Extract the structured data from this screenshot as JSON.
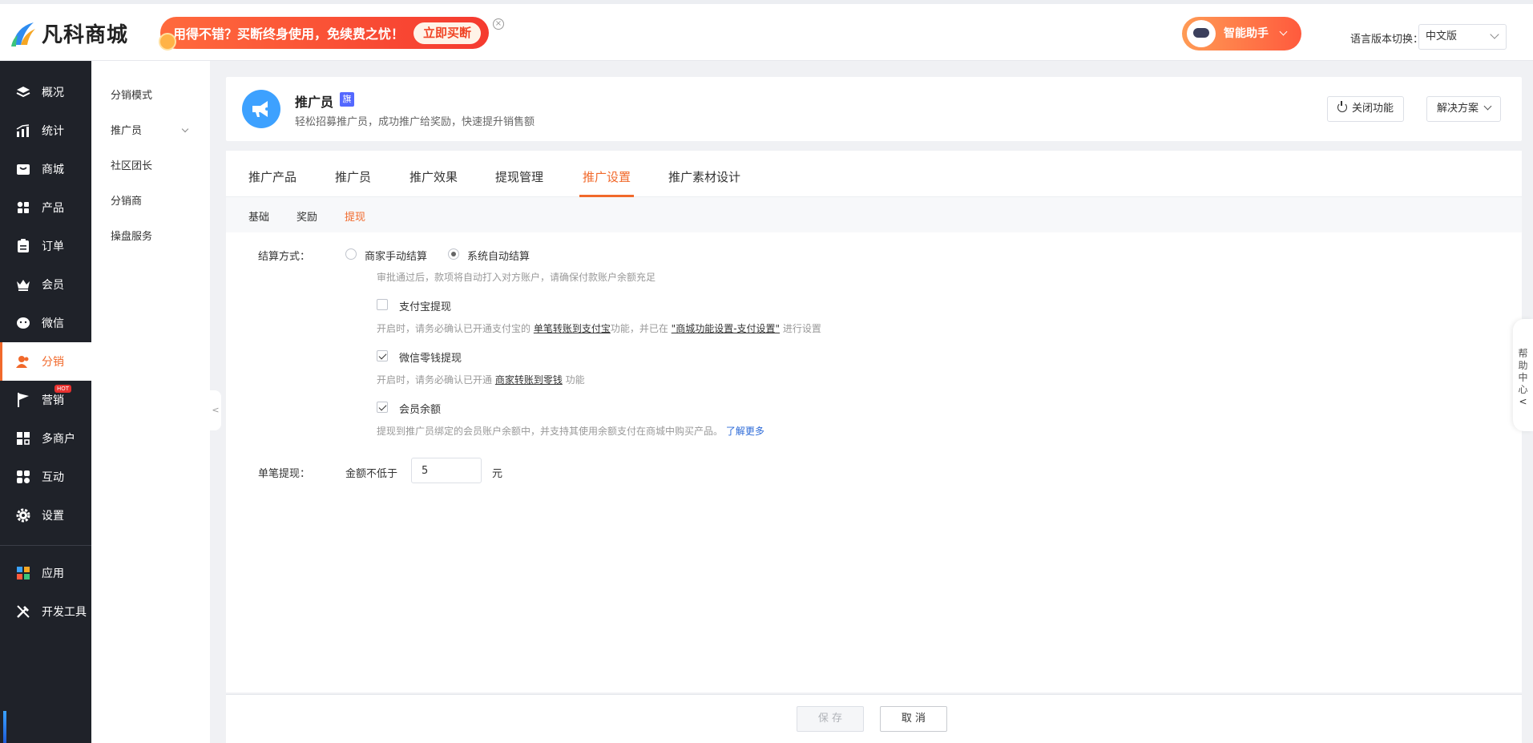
{
  "brand": {
    "name": "凡科商城"
  },
  "promo": {
    "text": "用得不错？买断终身使用，免续费之忧！",
    "button": "立即买断",
    "close": "×"
  },
  "assistant": {
    "label": "智能助手"
  },
  "language": {
    "label": "语言版本切换：",
    "value": "中文版"
  },
  "sidebar": {
    "items": [
      {
        "label": "概况",
        "icon": "layers-icon"
      },
      {
        "label": "统计",
        "icon": "chart-icon"
      },
      {
        "label": "商城",
        "icon": "store-icon"
      },
      {
        "label": "产品",
        "icon": "grid-icon"
      },
      {
        "label": "订单",
        "icon": "order-icon"
      },
      {
        "label": "会员",
        "icon": "crown-icon"
      },
      {
        "label": "微信",
        "icon": "wechat-icon"
      },
      {
        "label": "分销",
        "icon": "users-icon"
      },
      {
        "label": "营销",
        "icon": "flag-icon",
        "badge": "HOT"
      },
      {
        "label": "多商户",
        "icon": "multi-store-icon"
      },
      {
        "label": "互动",
        "icon": "interact-icon"
      },
      {
        "label": "设置",
        "icon": "gear-icon"
      },
      {
        "label": "应用",
        "icon": "apps-icon"
      },
      {
        "label": "开发工具",
        "icon": "tools-icon"
      }
    ]
  },
  "subnav": {
    "items": [
      {
        "label": "分销模式"
      },
      {
        "label": "推广员"
      },
      {
        "label": "社区团长"
      },
      {
        "label": "分销商"
      },
      {
        "label": "操盘服务"
      }
    ]
  },
  "header": {
    "title": "推广员",
    "badge": "旗",
    "description": "轻松招募推广员，成功推广给奖励，快速提升销售额",
    "close_button": "关闭功能",
    "solution_button": "解决方案"
  },
  "tabs": {
    "items": [
      {
        "label": "推广产品"
      },
      {
        "label": "推广员"
      },
      {
        "label": "推广效果"
      },
      {
        "label": "提现管理"
      },
      {
        "label": "推广设置"
      },
      {
        "label": "推广素材设计"
      }
    ],
    "active": "推广设置"
  },
  "subtabs": {
    "items": [
      {
        "label": "基础"
      },
      {
        "label": "奖励"
      },
      {
        "label": "提现"
      }
    ],
    "active": "提现"
  },
  "form": {
    "settlement": {
      "label": "结算方式：",
      "option_manual": "商家手动结算",
      "option_auto": "系统自动结算",
      "selected": "系统自动结算",
      "hint": "审批通过后，款项将自动打入对方账户，请确保付款账户余额充足"
    },
    "alipay": {
      "label": "支付宝提现",
      "checked": false,
      "hint_prefix": "开启时，请务必确认已开通支付宝的 ",
      "hint_link1": "单笔转账到支付宝",
      "hint_mid": "功能，并已在 ",
      "hint_link2": "\"商城功能设置-支付设置\"",
      "hint_suffix": " 进行设置"
    },
    "wechat": {
      "label": "微信零钱提现",
      "checked": true,
      "hint_prefix": "开启时，请务必确认已开通 ",
      "hint_link": "商家转账到零钱",
      "hint_suffix": " 功能"
    },
    "balance": {
      "label": "会员余额",
      "checked": true,
      "hint": "提现到推广员绑定的会员账户余额中，并支持其使用余额支付在商城中购买产品。",
      "learn_more": "了解更多"
    },
    "single": {
      "label": "单笔提现：",
      "prefix": "金额不低于",
      "value": "5",
      "unit": "元"
    }
  },
  "footer": {
    "save": "保 存",
    "cancel": "取 消"
  },
  "help": {
    "label": "帮助中心",
    "arrow": "<"
  },
  "collapse": {
    "label": "<"
  },
  "colors": {
    "accent": "#f1692b",
    "sidebar_bg": "#1f2229",
    "link": "#2d6bd8"
  }
}
